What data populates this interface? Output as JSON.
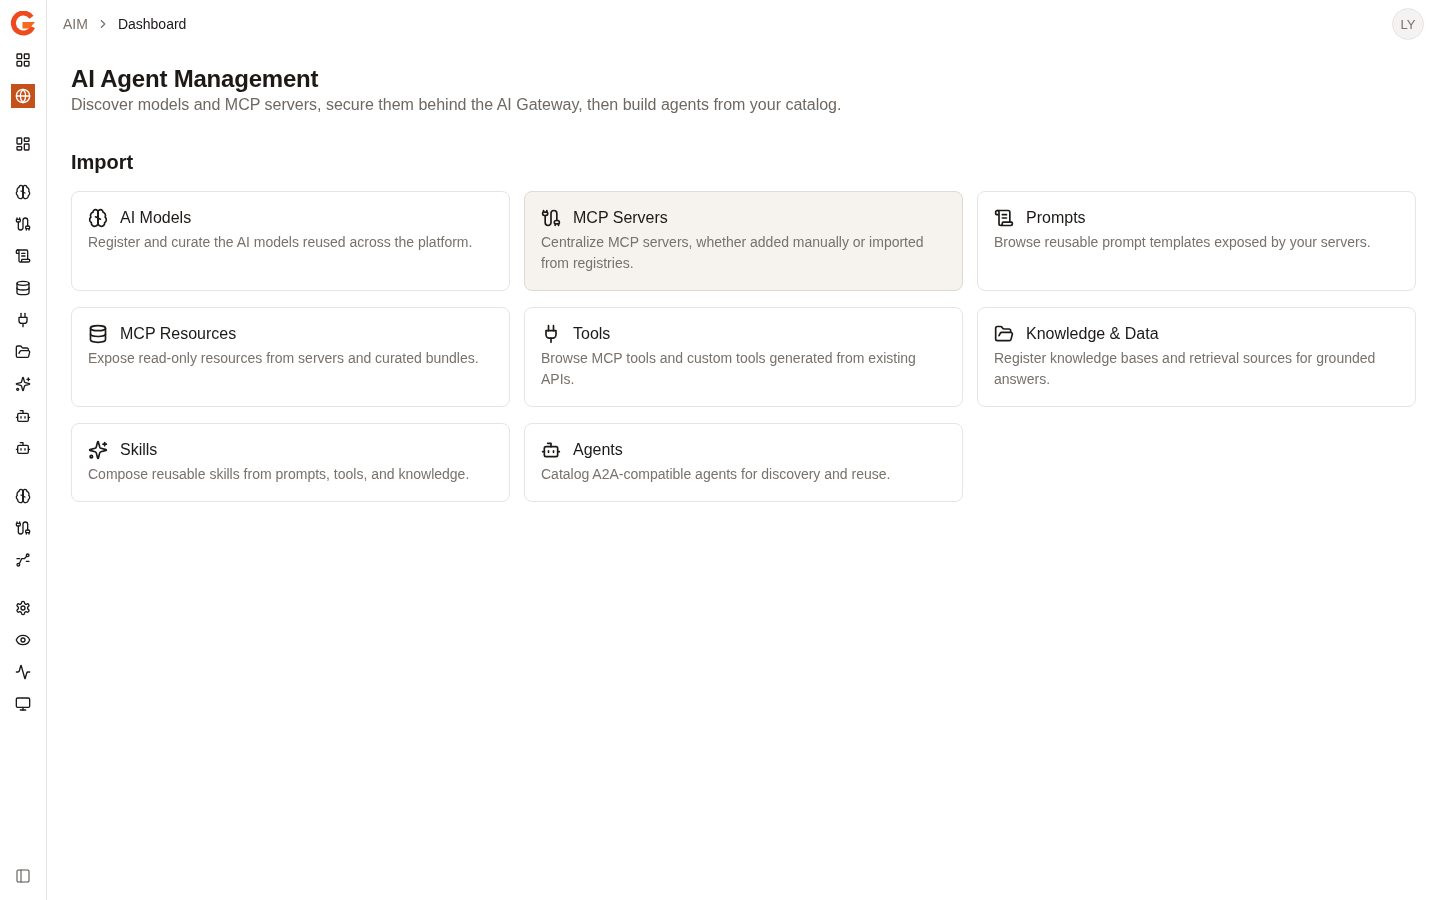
{
  "sidebar": {
    "groups": [
      {
        "items": [
          {
            "selected": false
          },
          {
            "selected": true
          }
        ]
      },
      {
        "items": [
          {
            "selected": false
          }
        ]
      },
      {
        "items": [
          {
            "selected": false
          },
          {
            "selected": false
          },
          {
            "selected": false
          },
          {
            "selected": false
          },
          {
            "selected": false
          },
          {
            "selected": false
          },
          {
            "selected": false
          },
          {
            "selected": false
          },
          {
            "selected": false
          }
        ]
      },
      {
        "items": [
          {
            "selected": false
          },
          {
            "selected": false
          },
          {
            "selected": false
          }
        ]
      },
      {
        "items": [
          {
            "selected": false
          },
          {
            "selected": false
          },
          {
            "selected": false
          },
          {
            "selected": false
          }
        ]
      }
    ]
  },
  "breadcrumb": [
    {
      "label": "AIM",
      "current": false
    },
    {
      "label": "Dashboard",
      "current": true
    }
  ],
  "user": {
    "initials": "LY"
  },
  "page": {
    "title": "AI Agent Management",
    "subtitle": "Discover models and MCP servers, secure them behind the AI Gateway, then build agents from your catalog."
  },
  "section": {
    "title": "Import",
    "cards": [
      {
        "title": "AI Models",
        "description": "Register and curate the AI models reused across the platform.",
        "highlighted": false
      },
      {
        "title": "MCP Servers",
        "description": "Centralize MCP servers, whether added manually or imported from registries.",
        "highlighted": true
      },
      {
        "title": "Prompts",
        "description": "Browse reusable prompt templates exposed by your servers.",
        "highlighted": false
      },
      {
        "title": "MCP Resources",
        "description": "Expose read-only resources from servers and curated bundles.",
        "highlighted": false
      },
      {
        "title": "Tools",
        "description": "Browse MCP tools and custom tools generated from existing APIs.",
        "highlighted": false
      },
      {
        "title": "Knowledge & Data",
        "description": "Register knowledge bases and retrieval sources for grounded answers.",
        "highlighted": false
      },
      {
        "title": "Skills",
        "description": "Compose reusable skills from prompts, tools, and knowledge.",
        "highlighted": false
      },
      {
        "title": "Agents",
        "description": "Catalog A2A-compatible agents for discovery and reuse.",
        "highlighted": false
      }
    ]
  }
}
